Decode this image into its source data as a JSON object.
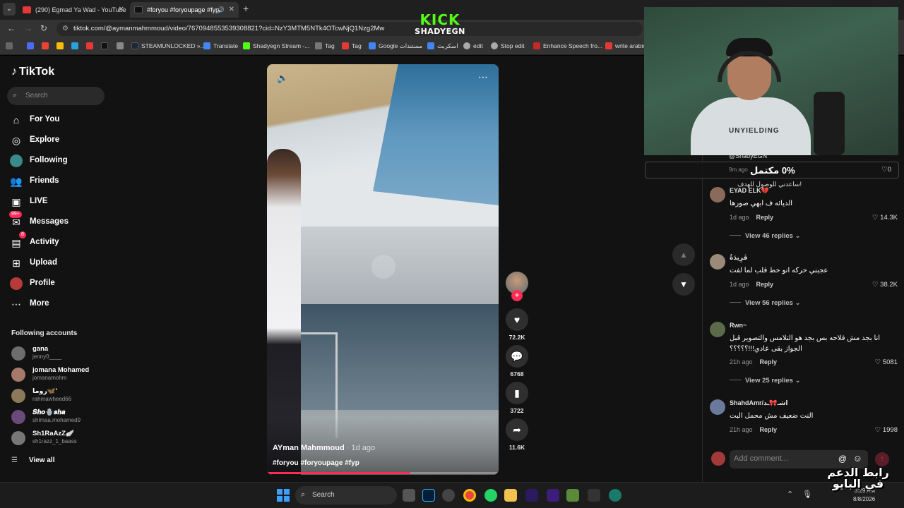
{
  "browser": {
    "tabs": [
      {
        "title": "(290) Egmad Ya Wad - YouTube",
        "color": "#e53935"
      },
      {
        "title": "#foryou #foryoupage #fyp",
        "color": "#111111"
      }
    ],
    "url": "tiktok.com/@aymanmahmmoud/video/7670948553539308821?cid=NzY3MTM5NTk4OTcwNjQ1Nzg2Mw",
    "bookmarks": [
      "STEAMUNLOCKED »...",
      "Translate",
      "Shadyegn Stream -...",
      "Tag",
      "Tag",
      "Google مستندات",
      "اسكربت",
      "edit",
      "Stop edit",
      "Enhance Speech fro...",
      "write arabic"
    ]
  },
  "overlay": {
    "kick_line1": "KICK",
    "kick_line2": "SHADYEGN",
    "arabic_corner": "رابط الدعم في البايو",
    "percent_banner": "0% مكتمل",
    "webcam_shirt": "UNYIELDING"
  },
  "tiktok": {
    "logo": "TikTok",
    "search_placeholder": "Search",
    "nav": [
      {
        "label": "For You",
        "icon": "home-icon"
      },
      {
        "label": "Explore",
        "icon": "compass-icon"
      },
      {
        "label": "Following",
        "icon": "following-icon"
      },
      {
        "label": "Friends",
        "icon": "friends-icon"
      },
      {
        "label": "LIVE",
        "icon": "live-icon"
      },
      {
        "label": "Messages",
        "icon": "messages-icon",
        "badge": "99+"
      },
      {
        "label": "Activity",
        "icon": "activity-icon",
        "badge": "8"
      },
      {
        "label": "Upload",
        "icon": "upload-icon"
      },
      {
        "label": "Profile",
        "icon": "profile-icon"
      },
      {
        "label": "More",
        "icon": "more-icon"
      }
    ],
    "following_title": "Following accounts",
    "accounts": [
      {
        "name": "gana",
        "handle": "jenny0____"
      },
      {
        "name": "jomana Mohamed",
        "handle": "jomanamohm"
      },
      {
        "name": "روما🦋'",
        "handle": "rahmawheed66"
      },
      {
        "name": "𝑺𝒉𝒐🪬𝒔𝒉𝒂",
        "handle": "shimaa.mohamed9"
      },
      {
        "name": "Sh1RaAzZ🪽",
        "handle": "sh1razz_1_baass"
      }
    ],
    "view_all": "View all",
    "video": {
      "author": "AYman Mahmmoud",
      "ago": "· 1d ago",
      "tags": "#foryou #foryoupage #fyp",
      "progress": 0.62
    },
    "actions": {
      "likes": "72.2K",
      "comments": "6768",
      "saves": "3722",
      "shares": "11.6K"
    },
    "pinned_comment": {
      "name": "@ShadyEGN",
      "ago": "9m ago",
      "likes": "0",
      "below_text": "ساعدني للوصول للهدف!"
    },
    "comments": [
      {
        "name": "EYAD ELK💔",
        "text": "الديائه ف ابهي صورها",
        "ago": "1d ago",
        "reply": "Reply",
        "likes": "14.3K",
        "replies": "View 46 replies"
      },
      {
        "name": "فَرِيدَةٌ",
        "text": "عجبني حركه انو حط قلب لما لفت",
        "ago": "1d ago",
        "reply": "Reply",
        "likes": "38.2K",
        "replies": "View 56 replies"
      },
      {
        "name": "Rwn~",
        "text": "انا بجد مش فلاحه بس بجد هو التلامس والتصوير قبل الجواز بقى عادي!!!؟؟؟؟؟",
        "ago": "21h ago",
        "reply": "Reply",
        "likes": "5081",
        "replies": "View 25 replies"
      },
      {
        "name": "ShahdAmr/اشـ🎀ـد",
        "text": "النت ضعيف مش محمل البت",
        "ago": "21h ago",
        "reply": "Reply",
        "likes": "1998",
        "replies": ""
      }
    ],
    "comment_placeholder": "Add comment..."
  },
  "taskbar": {
    "search_label": "Search",
    "date": "8/8/2026",
    "time": "3:29 AM"
  }
}
